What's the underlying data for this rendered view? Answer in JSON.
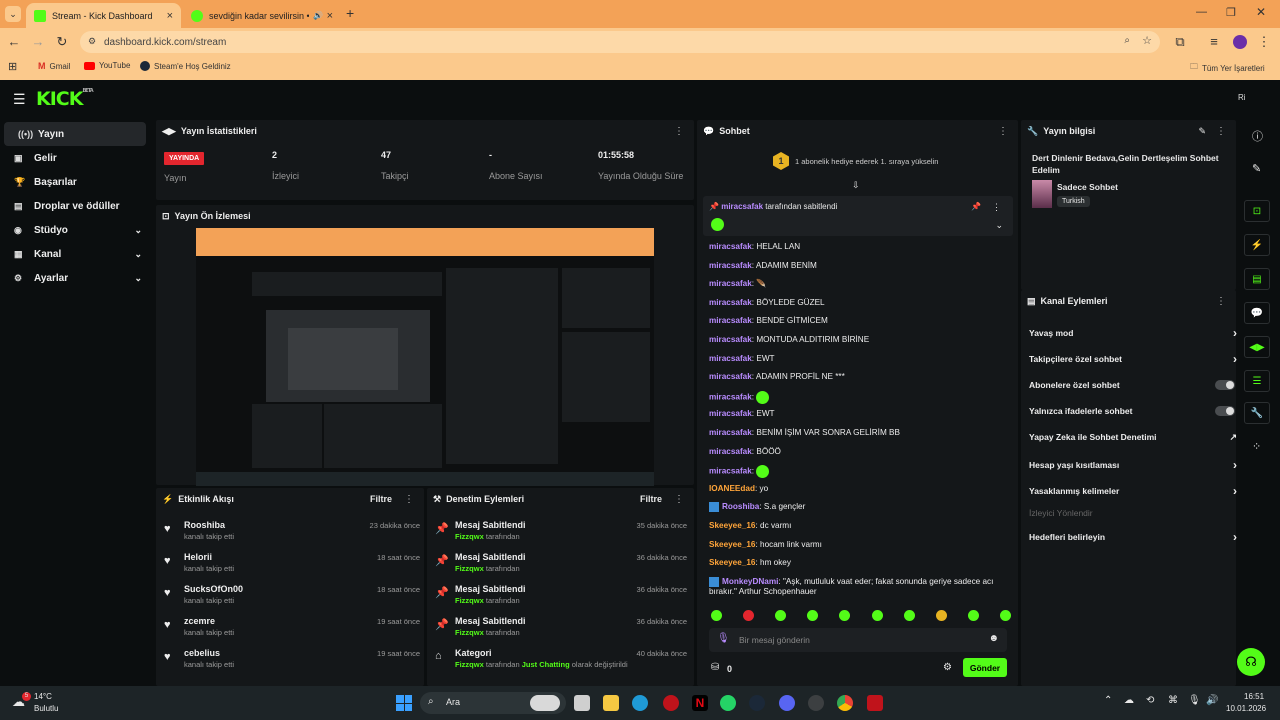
{
  "browser": {
    "tabs": [
      {
        "title": "Stream - Kick Dashboard",
        "active": true
      },
      {
        "title": "sevdiğin kadar sevilirsin • şi",
        "active": false
      }
    ],
    "url": "dashboard.kick.com/stream",
    "bookmarks": [
      "Gmail",
      "YouTube",
      "Steam'e Hoş Geldiniz"
    ],
    "all_bookmarks": "Tüm Yer İşaretleri"
  },
  "app": {
    "logo": "KICK",
    "logo_badge": "BETA",
    "user_initials": "Ri"
  },
  "sidebar": {
    "items": [
      {
        "label": "Yayın",
        "icon": "broadcast-icon",
        "active": true
      },
      {
        "label": "Gelir",
        "icon": "wallet-icon"
      },
      {
        "label": "Başarılar",
        "icon": "trophy-icon"
      },
      {
        "label": "Droplar ve ödüller",
        "icon": "gift-icon"
      },
      {
        "label": "Stüdyo",
        "icon": "studio-icon",
        "expandable": true
      },
      {
        "label": "Kanal",
        "icon": "channel-icon",
        "expandable": true
      },
      {
        "label": "Ayarlar",
        "icon": "gear-icon",
        "expandable": true
      }
    ]
  },
  "stats": {
    "title": "Yayın İstatistikleri",
    "live_badge": "YAYINDA",
    "live_label": "Yayın",
    "viewers": "2",
    "viewers_label": "İzleyici",
    "followers": "47",
    "followers_label": "Takipçi",
    "subs": "-",
    "subs_label": "Abone Sayısı",
    "uptime": "01:55:58",
    "uptime_label": "Yayında Olduğu Süre"
  },
  "preview": {
    "title": "Yayın Ön İzlemesi"
  },
  "activity": {
    "title": "Etkinlik Akışı",
    "filter": "Filtre",
    "items": [
      {
        "name": "Rooshiba",
        "action": "kanalı takip etti",
        "time": "23 dakika önce"
      },
      {
        "name": "Helorii",
        "action": "kanalı takip etti",
        "time": "18 saat önce"
      },
      {
        "name": "SucksOfOn00",
        "action": "kanalı takip etti",
        "time": "18 saat önce"
      },
      {
        "name": "zcemre",
        "action": "kanalı takip etti",
        "time": "19 saat önce"
      },
      {
        "name": "cebelius",
        "action": "kanalı takip etti",
        "time": "19 saat önce"
      }
    ]
  },
  "moderation": {
    "title": "Denetim Eylemleri",
    "filter": "Filtre",
    "items": [
      {
        "title": "Mesaj Sabitlendi",
        "user": "Fizzqwx",
        "suffix": "tarafından",
        "time": "35 dakika önce"
      },
      {
        "title": "Mesaj Sabitlendi",
        "user": "Fizzqwx",
        "suffix": "tarafından",
        "time": "36 dakika önce"
      },
      {
        "title": "Mesaj Sabitlendi",
        "user": "Fizzqwx",
        "suffix": "tarafından",
        "time": "36 dakika önce"
      },
      {
        "title": "Mesaj Sabitlendi",
        "user": "Fizzqwx",
        "suffix": "tarafından",
        "time": "36 dakika önce"
      },
      {
        "title": "Kategori",
        "user": "Fizzqwx",
        "suffix": "tarafından",
        "category": "Just Chatting",
        "suffix2": "olarak değiştirildi",
        "time": "40 dakika önce"
      }
    ]
  },
  "chat": {
    "title": "Sohbet",
    "gift_banner": "1 abonelik hediye ederek 1. sıraya yükselin",
    "gift_rank": "1",
    "pinned_by_user": "miracsafak",
    "pinned_by_text": "tarafından sabitlendi",
    "messages": [
      {
        "user": "miracsafak",
        "color": "#b98cff",
        "text": "HELAL LAN"
      },
      {
        "user": "miracsafak",
        "color": "#b98cff",
        "text": "ADAMIM BENİM"
      },
      {
        "user": "miracsafak",
        "color": "#b98cff",
        "text": "",
        "emote": "feather"
      },
      {
        "user": "miracsafak",
        "color": "#b98cff",
        "text": "BÖYLEDE GÜZEL"
      },
      {
        "user": "miracsafak",
        "color": "#b98cff",
        "text": "BENDE GİTMİCEM"
      },
      {
        "user": "miracsafak",
        "color": "#b98cff",
        "text": "MONTUDA ALDITIRIM BİRİNE"
      },
      {
        "user": "miracsafak",
        "color": "#b98cff",
        "text": "EWT"
      },
      {
        "user": "miracsafak",
        "color": "#b98cff",
        "text": "ADAMIN PROFİL NE ***"
      },
      {
        "user": "miracsafak",
        "color": "#b98cff",
        "text": "",
        "emote": "green"
      },
      {
        "user": "miracsafak",
        "color": "#b98cff",
        "text": "EWT"
      },
      {
        "user": "miracsafak",
        "color": "#b98cff",
        "text": "BENİM İŞİM VAR SONRA GELİRİM BB"
      },
      {
        "user": "miracsafak",
        "color": "#b98cff",
        "text": "BÖÖÖ"
      },
      {
        "user": "miracsafak",
        "color": "#b98cff",
        "text": "",
        "emote": "green"
      },
      {
        "user": "IOANEEdad",
        "color": "#ffa53a",
        "text": "yo"
      },
      {
        "user": "Rooshiba",
        "color": "#b98cff",
        "text": "S.a gençler",
        "badge": true
      },
      {
        "user": "Skeeyee_16",
        "color": "#ffa53a",
        "text": "dc varmı"
      },
      {
        "user": "Skeeyee_16",
        "color": "#ffa53a",
        "text": "hocam link varmı"
      },
      {
        "user": "Skeeyee_16",
        "color": "#ffa53a",
        "text": "hm okey"
      },
      {
        "user": "MonkeyDNami",
        "color": "#b98cff",
        "text": "\"Aşk, mutluluk vaat eder; fakat sonunda geriye sadece acı",
        "text2": "bırakır.\" Arthur Schopenhauer",
        "badge": true
      }
    ],
    "input_placeholder": "Bir mesaj gönderin",
    "points": "0",
    "send_label": "Gönder"
  },
  "stream_info": {
    "title": "Yayın bilgisi",
    "stream_title": "Dert Dinlenir Bedava,Gelin Dertleşelim Sohbet Edelim",
    "category": "Sadece Sohbet",
    "language": "Turkish"
  },
  "channel_actions": {
    "title": "Kanal Eylemleri",
    "items": [
      {
        "label": "Yavaş mod",
        "type": "arrow"
      },
      {
        "label": "Takipçilere özel sohbet",
        "type": "arrow"
      },
      {
        "label": "Abonelere özel sohbet",
        "type": "toggle"
      },
      {
        "label": "Yalnızca ifadelerle sohbet",
        "type": "toggle"
      },
      {
        "label": "Yapay Zeka ile Sohbet Denetimi",
        "type": "external"
      },
      {
        "label": "Hesap yaşı kısıtlaması",
        "type": "arrow"
      },
      {
        "label": "Yasaklanmış kelimeler",
        "type": "arrow"
      },
      {
        "label": "İzleyici Yönlendir",
        "type": "disabled"
      },
      {
        "label": "Hedefleri belirleyin",
        "type": "arrow"
      }
    ]
  },
  "taskbar": {
    "weather_temp": "14°C",
    "weather_desc": "Bulutlu",
    "weather_badge": "5",
    "search": "Ara",
    "time": "16:51",
    "date": "10.01.2026"
  },
  "colors": {
    "accent": "#53fc18",
    "live": "#e3262e",
    "chrome": "#f3a257"
  }
}
